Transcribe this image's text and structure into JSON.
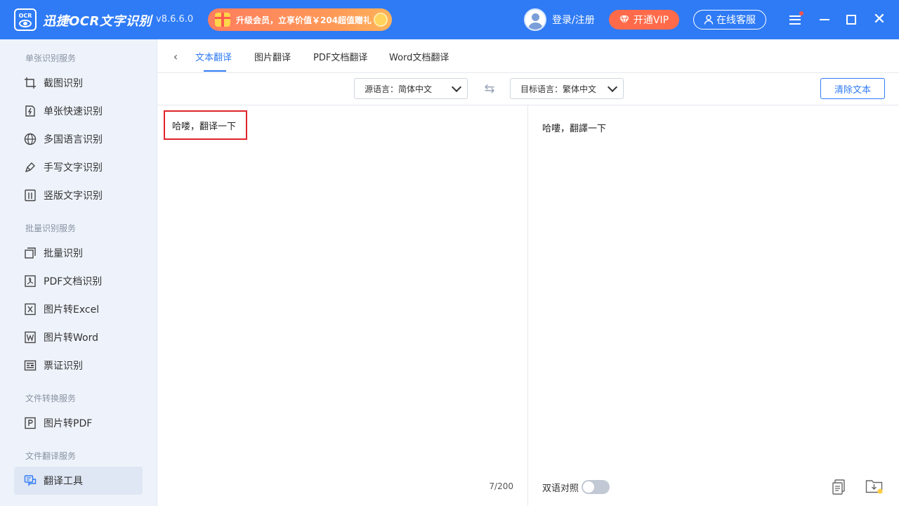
{
  "titlebar": {
    "logo_text": "OCR",
    "app_name": "迅捷OCR文字识别",
    "version": "v8.6.6.0",
    "promo": "升级会员，立享价值￥204超值赠礼",
    "login": "登录/注册",
    "vip": "开通VIP",
    "service": "在线客服"
  },
  "sidebar": {
    "sections": [
      {
        "title": "单张识别服务",
        "items": [
          "截图识别",
          "单张快速识别",
          "多国语言识别",
          "手写文字识别",
          "竖版文字识别"
        ]
      },
      {
        "title": "批量识别服务",
        "items": [
          "批量识别",
          "PDF文档识别",
          "图片转Excel",
          "图片转Word",
          "票证识别"
        ]
      },
      {
        "title": "文件转换服务",
        "items": [
          "图片转PDF"
        ]
      },
      {
        "title": "文件翻译服务",
        "items": [
          "翻译工具"
        ]
      }
    ]
  },
  "tabs": [
    "文本翻译",
    "图片翻译",
    "PDF文档翻译",
    "Word文档翻译"
  ],
  "toolbar": {
    "source_lang": "源语言：简体中文",
    "target_lang": "目标语言：繁体中文",
    "clear": "清除文本"
  },
  "source": {
    "text": "哈喽，翻译一下",
    "count": "7/200"
  },
  "target": {
    "text": "哈嘍，翻譯一下",
    "bilingual": "双语对照",
    "bilingual_on": false
  },
  "colors": {
    "primary": "#2f7bf5",
    "vip": "#ff6b4a",
    "highlight": "#e0242a"
  }
}
